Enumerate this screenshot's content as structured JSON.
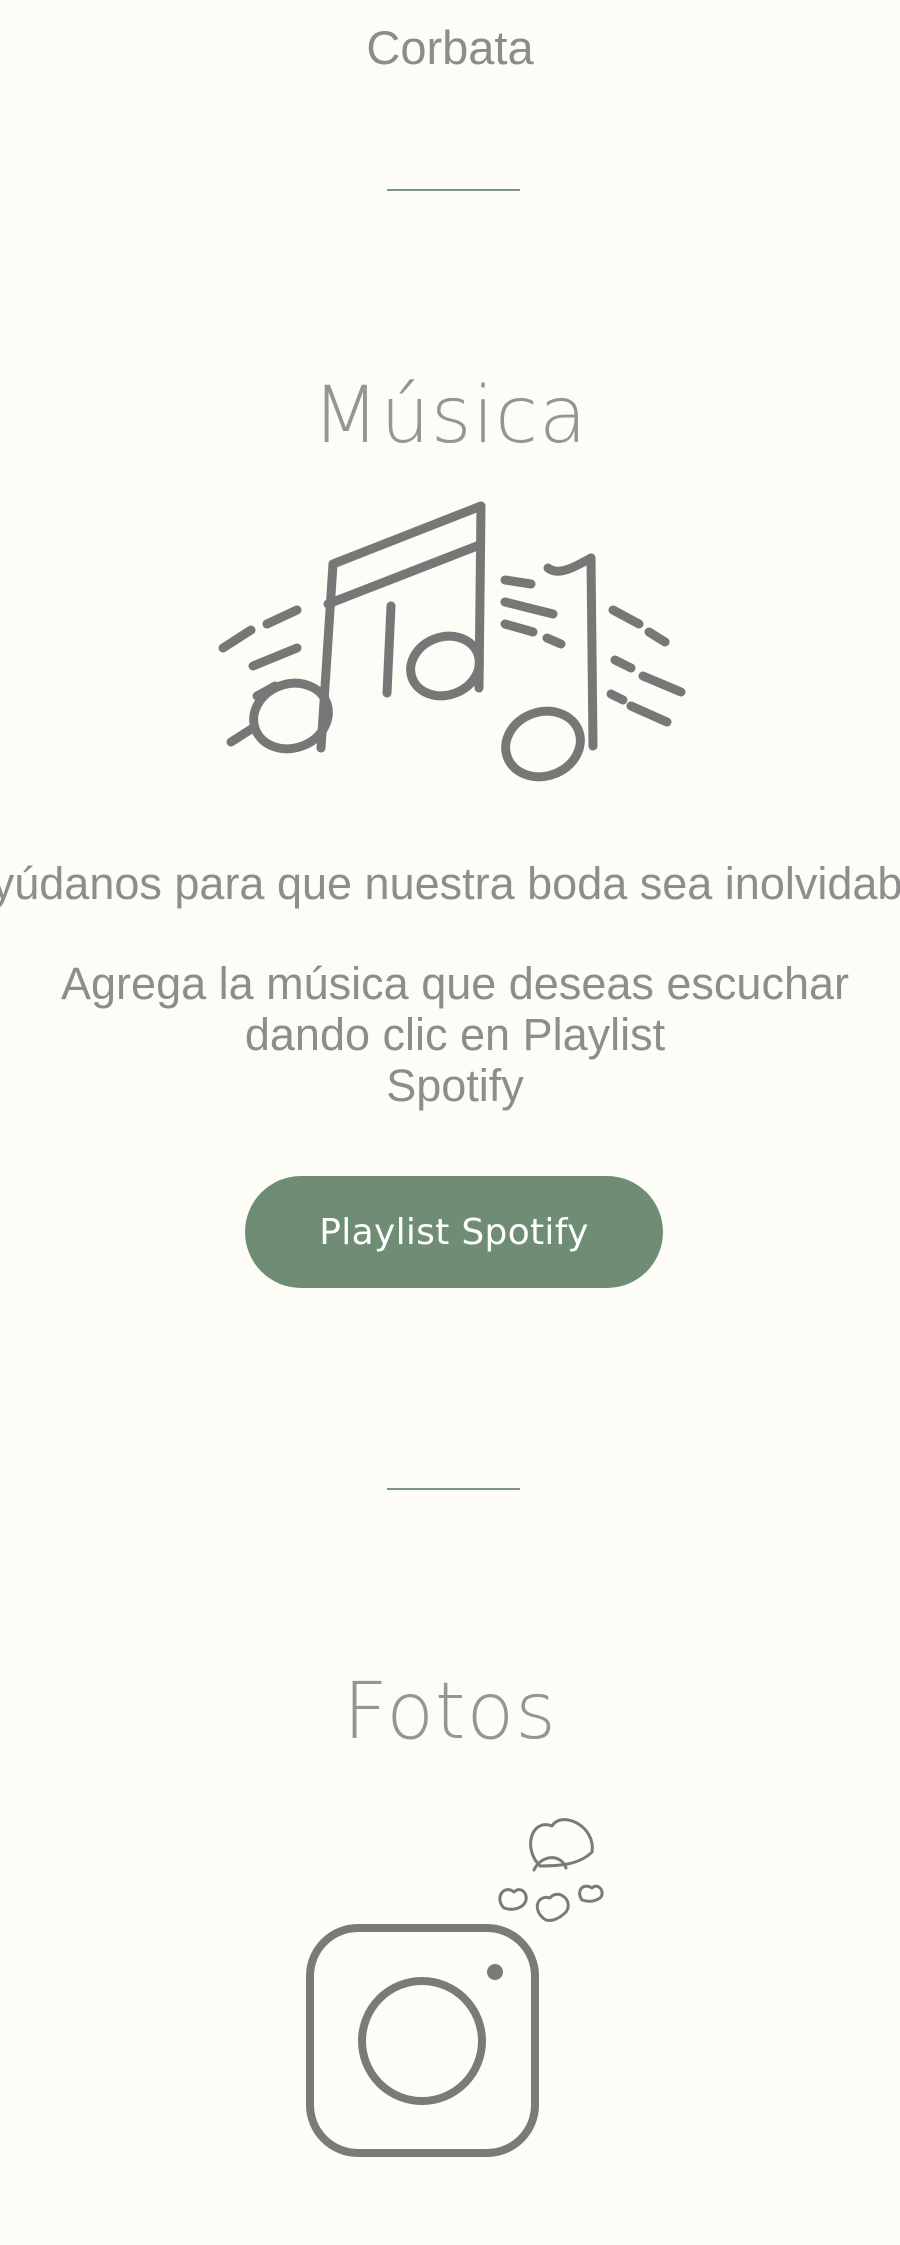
{
  "dress_code": {
    "item": "Corbata"
  },
  "music": {
    "title": "Música",
    "icon": "music-notes-icon",
    "intro": "Ayúdanos para que nuestra boda sea inolvidable",
    "instructions_line1": "Agrega la música que deseas escuchar",
    "instructions_line2": "dando clic en Playlist",
    "instructions_line3": "Spotify",
    "button_label": "Playlist Spotify"
  },
  "photos": {
    "title": "Fotos",
    "icon": "instagram-hearts-icon"
  },
  "colors": {
    "background": "#fdfcf6",
    "accent": "#6f8c74",
    "divider": "#7d9683",
    "text": "#8d8d8d"
  }
}
